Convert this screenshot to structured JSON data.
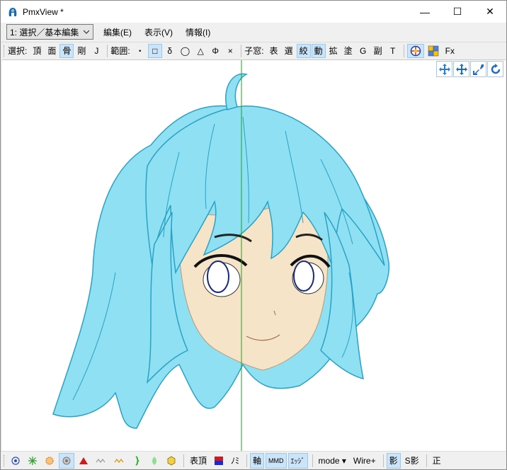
{
  "window": {
    "title": "PmxView *",
    "minimize_glyph": "—",
    "maximize_glyph": "☐",
    "close_glyph": "✕"
  },
  "menubar": {
    "mode_select_value": "1: 選択／基本編集",
    "items": [
      "編集(E)",
      "表示(V)",
      "情報(I)"
    ]
  },
  "toolbar": {
    "select_label": "選択:",
    "select_buttons": [
      "頂",
      "面",
      "骨",
      "剛",
      "J"
    ],
    "range_label": "範囲:",
    "range_buttons": [
      "・",
      "□",
      "δ",
      "◯",
      "△",
      "Φ",
      "×"
    ],
    "child_label": "子窓:",
    "child_buttons": [
      "表",
      "選",
      "絞",
      "動",
      "拡",
      "塗",
      "G",
      "副",
      "T"
    ],
    "fx_label": "Fx"
  },
  "bottombar": {
    "table_label": "表頂",
    "nomi_label": "ﾉﾐ",
    "axis_label": "軸",
    "mmd_label": "MMD",
    "edge_label": "ｴｯｼﾞ",
    "mode_label": "mode ▾",
    "wire_label": "Wire+",
    "shadow_label": "影",
    "sshadow_label": "S影",
    "sei_label": "正"
  },
  "colors": {
    "hair": "#8fe0f2",
    "hair_dark": "#3fb8d6",
    "skin": "#f5e4c8",
    "axis_green": "#1aa31a",
    "active_bg": "#cce4f7"
  }
}
